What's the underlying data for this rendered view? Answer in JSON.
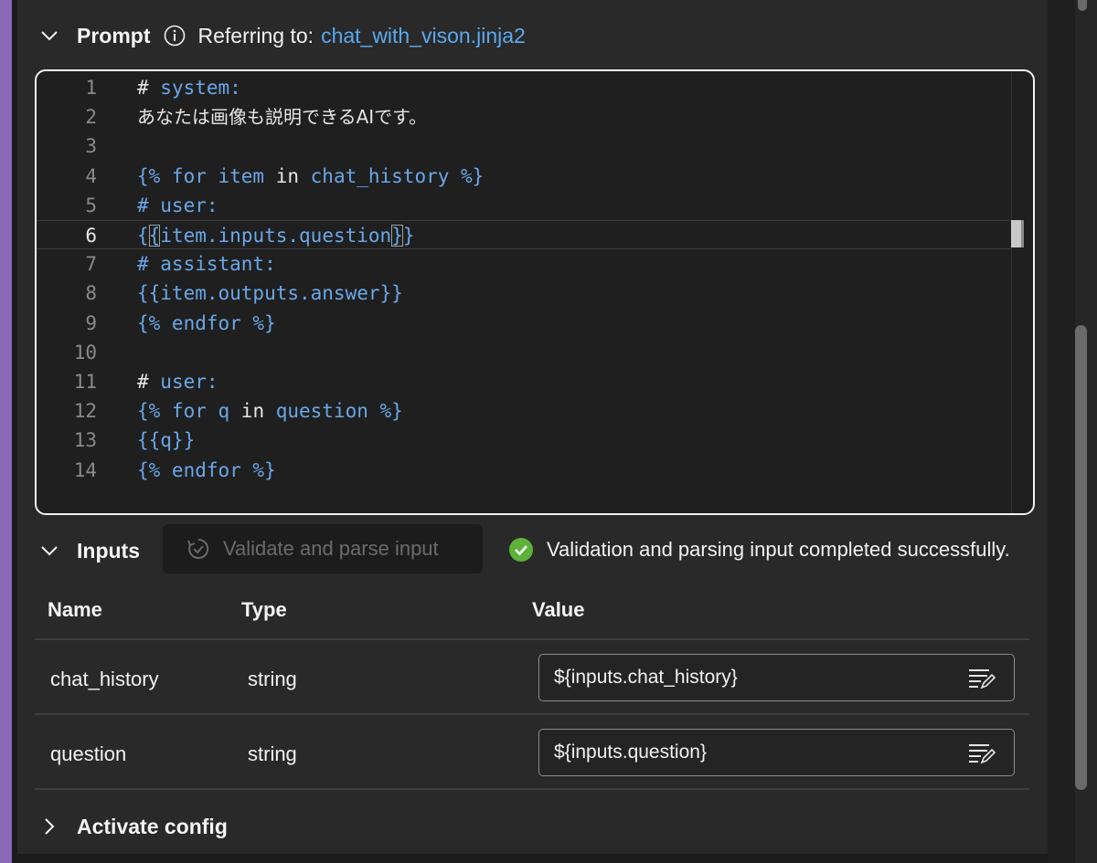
{
  "prompt": {
    "title": "Prompt",
    "referring_label": "Referring to:",
    "file_link": "chat_with_vison.jinja2"
  },
  "editor": {
    "lines": [
      {
        "num": "1",
        "segments": [
          {
            "t": "# system:",
            "c": "mix1"
          }
        ]
      },
      {
        "num": "2",
        "segments": [
          {
            "t": "あなたは画像も説明できるAIです。",
            "c": "jp"
          }
        ]
      },
      {
        "num": "3",
        "segments": []
      },
      {
        "num": "4",
        "segments": [
          {
            "t": "{% for item in chat_history %}",
            "c": "mix4"
          }
        ]
      },
      {
        "num": "5",
        "segments": [
          {
            "t": "# user:",
            "c": "blue"
          }
        ]
      },
      {
        "num": "6",
        "segments": [
          {
            "t": "{{item.inputs.question}}",
            "c": "blue"
          }
        ]
      },
      {
        "num": "7",
        "segments": [
          {
            "t": "# assistant:",
            "c": "blue"
          }
        ]
      },
      {
        "num": "8",
        "segments": [
          {
            "t": "{{item.outputs.answer}}",
            "c": "blue"
          }
        ]
      },
      {
        "num": "9",
        "segments": [
          {
            "t": "{% endfor %}",
            "c": "blue"
          }
        ]
      },
      {
        "num": "10",
        "segments": []
      },
      {
        "num": "11",
        "segments": [
          {
            "t": "# user:",
            "c": "mix11"
          }
        ]
      },
      {
        "num": "12",
        "segments": [
          {
            "t": "{% for q in question %}",
            "c": "mix12"
          }
        ]
      },
      {
        "num": "13",
        "segments": [
          {
            "t": "{{q}}",
            "c": "blue"
          }
        ]
      },
      {
        "num": "14",
        "segments": [
          {
            "t": "{% endfor %}",
            "c": "blue"
          }
        ]
      }
    ],
    "active_line": "6"
  },
  "inputs": {
    "title": "Inputs",
    "validate_label": "Validate and parse input",
    "status_text": "Validation and parsing input completed successfully.",
    "columns": {
      "name": "Name",
      "type": "Type",
      "value": "Value"
    },
    "rows": [
      {
        "name": "chat_history",
        "type": "string",
        "value": "${inputs.chat_history}"
      },
      {
        "name": "question",
        "type": "string",
        "value": "${inputs.question}"
      }
    ]
  },
  "activate": {
    "title": "Activate config"
  },
  "colors": {
    "accent": "#8a6ab8",
    "link": "#5aa9ef",
    "code_keyword": "#6aa7e8",
    "success": "#5cb338"
  }
}
